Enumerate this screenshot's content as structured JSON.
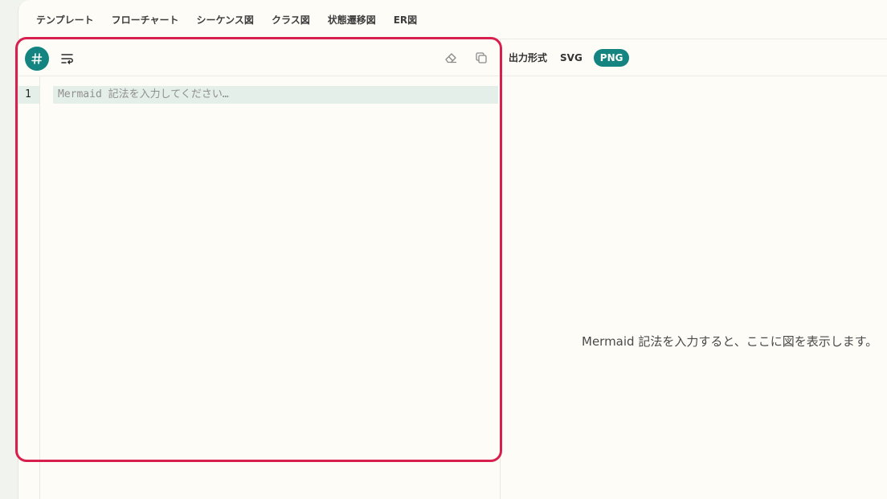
{
  "template_tabs": [
    "テンプレート",
    "フローチャート",
    "シーケンス図",
    "クラス図",
    "状態遷移図",
    "ER図"
  ],
  "editor": {
    "line_number": "1",
    "placeholder": "Mermaid 記法を入力してください…"
  },
  "preview": {
    "format_label": "出力形式",
    "formats": [
      "SVG",
      "PNG"
    ],
    "selected_format": "PNG",
    "empty_message": "Mermaid 記法を入力すると、ここに図を表示します。"
  },
  "colors": {
    "accent": "#13847f",
    "highlight_border": "#d8204f",
    "active_line": "#e5efea"
  },
  "icons": {
    "hash": "hash-icon",
    "wrap": "text-wrap-icon",
    "eraser": "eraser-icon",
    "copy": "copy-icon"
  }
}
